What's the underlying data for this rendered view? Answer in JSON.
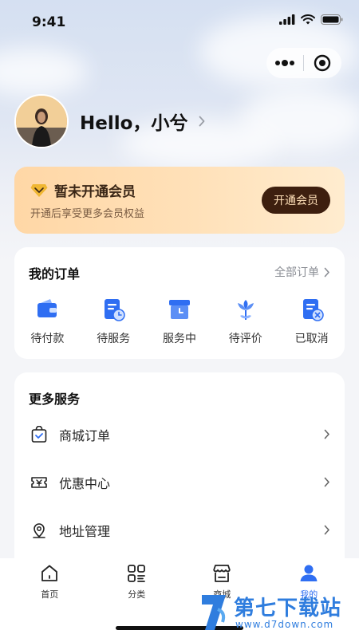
{
  "status_bar": {
    "time": "9:41"
  },
  "profile": {
    "greeting": "Hello，小兮"
  },
  "vip": {
    "title": "暂未开通会员",
    "subtitle": "开通后享受更多会员权益",
    "button": "开通会员"
  },
  "orders": {
    "title": "我的订单",
    "all_link": "全部订单",
    "items": [
      {
        "label": "待付款",
        "icon": "wallet-icon"
      },
      {
        "label": "待服务",
        "icon": "doc-clock-icon"
      },
      {
        "label": "服务中",
        "icon": "box-clock-icon"
      },
      {
        "label": "待评价",
        "icon": "flower-icon"
      },
      {
        "label": "已取消",
        "icon": "doc-cancel-icon"
      }
    ]
  },
  "services": {
    "title": "更多服务",
    "items": [
      {
        "label": "商城订单",
        "icon": "shopping-bag-icon"
      },
      {
        "label": "优惠中心",
        "icon": "coupon-icon"
      },
      {
        "label": "地址管理",
        "icon": "location-pin-icon"
      }
    ]
  },
  "tabbar": {
    "items": [
      {
        "label": "首页",
        "icon": "home-icon"
      },
      {
        "label": "分类",
        "icon": "grid-icon"
      },
      {
        "label": "商城",
        "icon": "store-icon"
      },
      {
        "label": "我的",
        "icon": "user-icon",
        "active": true
      }
    ]
  },
  "watermark": {
    "brand": "第七下载站",
    "url": "www.d7down.com"
  },
  "colors": {
    "accent": "#2f6ef2",
    "vip_button_bg": "#3d1f0f",
    "vip_gradient_start": "#ffd7a6"
  }
}
